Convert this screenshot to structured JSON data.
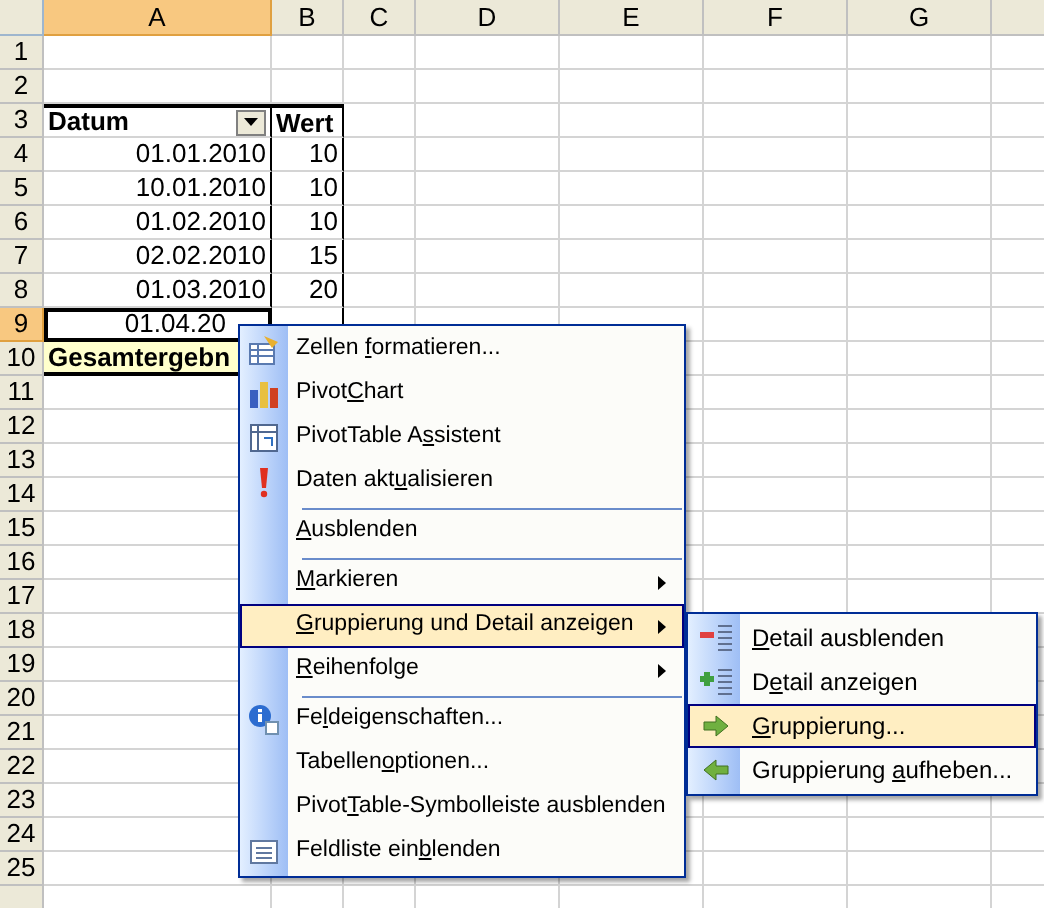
{
  "columns": [
    {
      "label": "A",
      "selected": true
    },
    {
      "label": "B",
      "selected": false
    },
    {
      "label": "C",
      "selected": false
    },
    {
      "label": "D",
      "selected": false
    },
    {
      "label": "E",
      "selected": false
    },
    {
      "label": "F",
      "selected": false
    },
    {
      "label": "G",
      "selected": false
    }
  ],
  "rows": [
    {
      "label": "1",
      "selected": false,
      "kind": "empty",
      "cells": []
    },
    {
      "label": "2",
      "selected": false,
      "kind": "empty",
      "cells": []
    },
    {
      "label": "3",
      "selected": false,
      "kind": "header",
      "cells": [
        "Datum",
        "Wert"
      ]
    },
    {
      "label": "4",
      "selected": false,
      "kind": "data",
      "cells": [
        "01.01.2010",
        "10"
      ]
    },
    {
      "label": "5",
      "selected": false,
      "kind": "data",
      "cells": [
        "10.01.2010",
        "10"
      ]
    },
    {
      "label": "6",
      "selected": false,
      "kind": "data",
      "cells": [
        "01.02.2010",
        "10"
      ]
    },
    {
      "label": "7",
      "selected": false,
      "kind": "data",
      "cells": [
        "02.02.2010",
        "15"
      ]
    },
    {
      "label": "8",
      "selected": false,
      "kind": "data",
      "cells": [
        "01.03.2010",
        "20"
      ]
    },
    {
      "label": "9",
      "selected": true,
      "kind": "covered",
      "cells": [
        "01.04.20"
      ]
    },
    {
      "label": "10",
      "selected": false,
      "kind": "total",
      "cells": [
        "Gesamtergebn"
      ]
    },
    {
      "label": "11",
      "selected": false,
      "kind": "empty",
      "cells": []
    },
    {
      "label": "12",
      "selected": false,
      "kind": "empty",
      "cells": []
    },
    {
      "label": "13",
      "selected": false,
      "kind": "empty",
      "cells": []
    },
    {
      "label": "14",
      "selected": false,
      "kind": "empty",
      "cells": []
    },
    {
      "label": "15",
      "selected": false,
      "kind": "empty",
      "cells": []
    },
    {
      "label": "16",
      "selected": false,
      "kind": "empty",
      "cells": []
    },
    {
      "label": "17",
      "selected": false,
      "kind": "empty",
      "cells": []
    },
    {
      "label": "18",
      "selected": false,
      "kind": "empty",
      "cells": []
    },
    {
      "label": "19",
      "selected": false,
      "kind": "empty",
      "cells": []
    },
    {
      "label": "20",
      "selected": false,
      "kind": "empty",
      "cells": []
    },
    {
      "label": "21",
      "selected": false,
      "kind": "empty",
      "cells": []
    },
    {
      "label": "22",
      "selected": false,
      "kind": "empty",
      "cells": []
    },
    {
      "label": "23",
      "selected": false,
      "kind": "empty",
      "cells": []
    },
    {
      "label": "24",
      "selected": false,
      "kind": "empty",
      "cells": []
    },
    {
      "label": "25",
      "selected": false,
      "kind": "empty",
      "cells": []
    }
  ],
  "context_menu": [
    {
      "kind": "format",
      "pre": "Zellen ",
      "key": "f",
      "post": "ormatieren...",
      "separator_before": false,
      "submenu": false,
      "selected": false
    },
    {
      "kind": "chart",
      "pre": "Pivot",
      "key": "C",
      "post": "hart",
      "separator_before": false,
      "submenu": false,
      "selected": false
    },
    {
      "kind": "wizard",
      "pre": "PivotTable A",
      "key": "s",
      "post": "sistent",
      "separator_before": false,
      "submenu": false,
      "selected": false
    },
    {
      "kind": "refresh",
      "pre": "Daten akt",
      "key": "u",
      "post": "alisieren",
      "separator_before": false,
      "submenu": false,
      "selected": false
    },
    {
      "kind": "plain",
      "key": "A",
      "post": "usblenden",
      "separator_before": true,
      "submenu": false,
      "selected": false
    },
    {
      "kind": "plain",
      "key": "M",
      "post": "arkieren",
      "separator_before": true,
      "submenu": true,
      "selected": false
    },
    {
      "kind": "plain",
      "key": "G",
      "post": "ruppierung und Detail anzeigen",
      "separator_before": false,
      "submenu": true,
      "selected": true
    },
    {
      "kind": "plain",
      "key": "R",
      "post": "eihenfolge",
      "separator_before": false,
      "submenu": true,
      "selected": false
    },
    {
      "kind": "info",
      "pre": "Fe",
      "key": "l",
      "post": "deigenschaften...",
      "separator_before": true,
      "submenu": false,
      "selected": false
    },
    {
      "kind": "plain",
      "pre": "Tabellen",
      "key": "o",
      "post": "ptionen...",
      "separator_before": false,
      "submenu": false,
      "selected": false
    },
    {
      "kind": "plain",
      "pre": "Pivot",
      "key": "T",
      "post": "able-Symbolleiste ausblenden",
      "separator_before": false,
      "submenu": false,
      "selected": false
    },
    {
      "kind": "list",
      "pre": "Feldliste ein",
      "key": "b",
      "post": "lenden",
      "separator_before": false,
      "submenu": false,
      "selected": false
    }
  ],
  "submenu": [
    {
      "kind": "hide",
      "key": "D",
      "post": "etail ausblenden",
      "selected": false
    },
    {
      "kind": "show",
      "pre": "D",
      "key": "e",
      "post": "tail anzeigen",
      "selected": false
    },
    {
      "kind": "group",
      "key": "G",
      "post": "ruppierung...",
      "selected": true
    },
    {
      "kind": "ungroup",
      "pre": "Gruppierung ",
      "key": "a",
      "post": "ufheben...",
      "selected": false
    }
  ]
}
